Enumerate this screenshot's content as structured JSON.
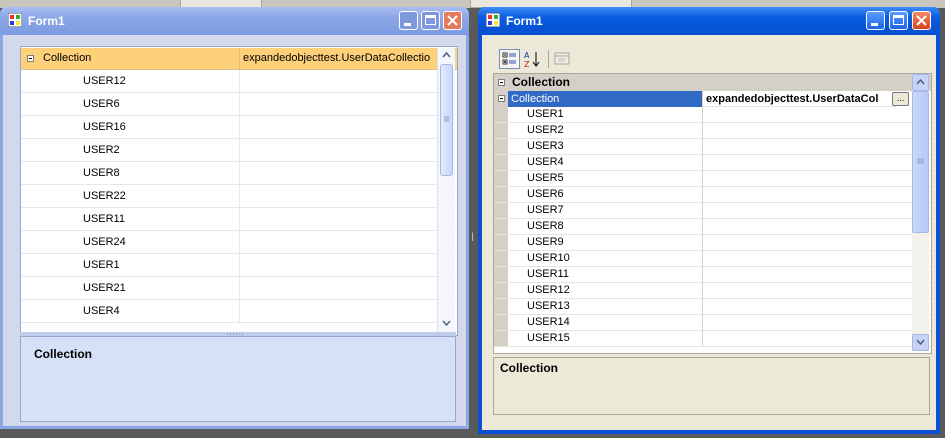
{
  "left_window": {
    "title": "Form1",
    "grid": {
      "property_name": "Collection",
      "property_value": "expandedobjecttest.UserDataCollectio",
      "items": [
        "USER12",
        "USER6",
        "USER16",
        "USER2",
        "USER8",
        "USER22",
        "USER11",
        "USER24",
        "USER1",
        "USER21",
        "USER4"
      ]
    },
    "description_title": "Collection"
  },
  "right_window": {
    "title": "Form1",
    "toolbar": {
      "categorized_icon": "categorized-icon",
      "alphabetical_icon": "alphabetical-sort-icon",
      "property_pages_icon": "property-pages-icon"
    },
    "grid": {
      "category": "Collection",
      "property_name": "Collection",
      "property_value": "expandedobjecttest.UserDataCol",
      "ellipsis": "...",
      "items": [
        "USER1",
        "USER2",
        "USER3",
        "USER4",
        "USER5",
        "USER6",
        "USER7",
        "USER8",
        "USER9",
        "USER10",
        "USER11",
        "USER12",
        "USER13",
        "USER14",
        "USER15"
      ]
    },
    "description_title": "Collection"
  },
  "colors": {
    "xp_blue_title": "#0a5fe0",
    "inactive_title": "#8aa6e6",
    "selection": "#316ac5",
    "hover_row": "#ffd07a"
  }
}
